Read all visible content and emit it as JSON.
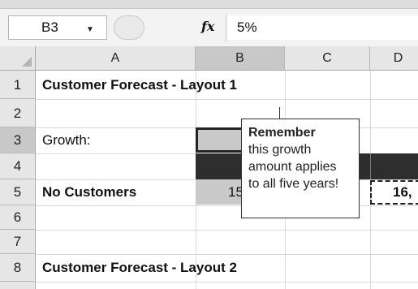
{
  "formula_bar": {
    "name_box": "B3",
    "fx_label": "fx",
    "formula": "5%"
  },
  "columns": [
    "A",
    "B",
    "C",
    "D"
  ],
  "rows": [
    "1",
    "2",
    "3",
    "4",
    "5",
    "6",
    "7",
    "8"
  ],
  "cells": {
    "A1": "Customer Forecast - Layout 1",
    "A3": "Growth:",
    "B3": "5%",
    "A5": "No Customers",
    "B5": "15",
    "D5": "16,",
    "A8": "Customer Forecast - Layout 2"
  },
  "comment": {
    "author": "Remember",
    "lines": [
      "this growth",
      "amount applies",
      "to all five years!"
    ]
  }
}
